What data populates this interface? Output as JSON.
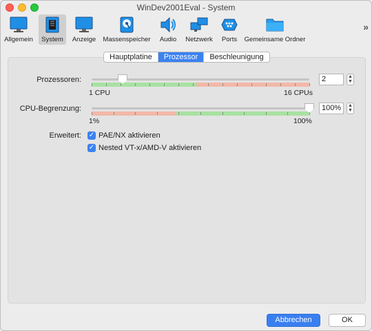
{
  "window": {
    "title": "WinDev2001Eval - System"
  },
  "toolbar": {
    "items": [
      {
        "label": "Allgemein",
        "icon": "monitor-icon"
      },
      {
        "label": "System",
        "icon": "chip-icon"
      },
      {
        "label": "Anzeige",
        "icon": "display-icon"
      },
      {
        "label": "Massenspeicher",
        "icon": "disk-icon"
      },
      {
        "label": "Audio",
        "icon": "speaker-icon"
      },
      {
        "label": "Netzwerk",
        "icon": "network-icon"
      },
      {
        "label": "Ports",
        "icon": "ports-icon"
      },
      {
        "label": "Gemeinsame Ordner",
        "icon": "folder-icon"
      }
    ],
    "selected": "System",
    "more": "»"
  },
  "tabs": {
    "items": [
      "Hauptplatine",
      "Prozessor",
      "Beschleunigung"
    ],
    "active": "Prozessor"
  },
  "processors": {
    "label": "Prozessoren:",
    "value": "2",
    "min_label": "1 CPU",
    "max_label": "16 CPUs",
    "min": 1,
    "max": 16,
    "current": 2
  },
  "cpu_limit": {
    "label": "CPU-Begrenzung:",
    "value": "100%",
    "min_label": "1%",
    "max_label": "100%",
    "current_percent": 100
  },
  "extended": {
    "label": "Erweitert:",
    "options": [
      {
        "label": "PAE/NX aktivieren",
        "checked": true
      },
      {
        "label": "Nested VT-x/AMD-V aktivieren",
        "checked": true
      }
    ]
  },
  "buttons": {
    "cancel": "Abbrechen",
    "ok": "OK"
  },
  "colors": {
    "accent": "#3b82f2",
    "zone_good": "#a8e2a2",
    "zone_bad": "#f2b8a8"
  }
}
